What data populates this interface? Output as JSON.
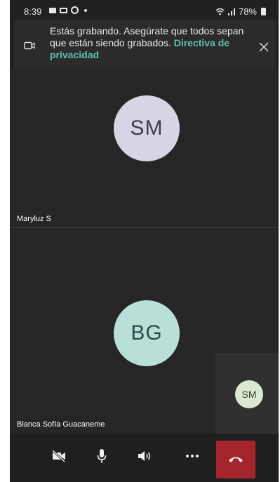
{
  "status_bar": {
    "time": "8:39",
    "battery": "78%",
    "icons": [
      "youtube-icon",
      "gallery-icon",
      "whatsapp-icon",
      "notification-dot-icon",
      "wifi-icon",
      "signal-icon",
      "battery-icon"
    ]
  },
  "banner": {
    "message": "Estás grabando. Asegúrate que todos sepan que están siendo grabados.",
    "link": "Directiva de privacidad",
    "icons": [
      "camera-icon",
      "close-icon"
    ]
  },
  "participants": [
    {
      "initials": "SM",
      "name": "Maryluz S",
      "color": "#d8d4e4"
    },
    {
      "initials": "BG",
      "name": "Blanca Sofía Guacaneme",
      "color": "#b9dfd9"
    }
  ],
  "self_view": {
    "initials": "SM",
    "color": "#dde8d3"
  },
  "controls": {
    "icons": [
      "video-off-icon",
      "microphone-icon",
      "speaker-icon",
      "more-options-icon",
      "hang-up-icon"
    ],
    "hangup_color": "#a4262c"
  }
}
